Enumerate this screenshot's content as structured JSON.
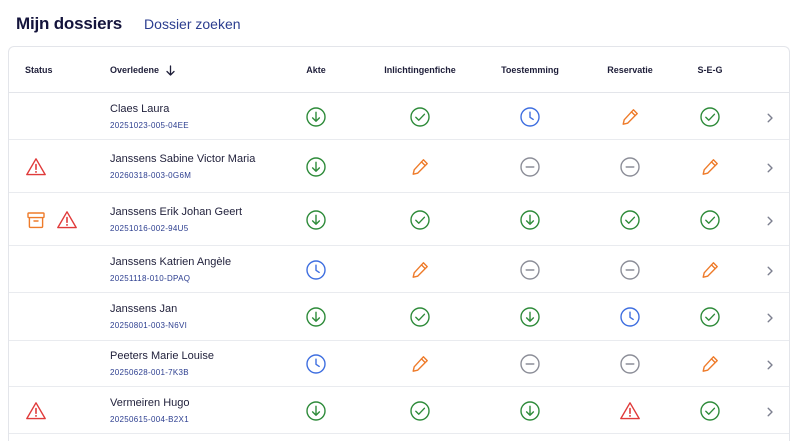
{
  "header": {
    "title": "Mijn dossiers",
    "search_link": "Dossier zoeken"
  },
  "table": {
    "columns": {
      "status": "Status",
      "overledene": "Overledene",
      "akte": "Akte",
      "inlichtingenfiche": "Inlichtingenfiche",
      "toestemming": "Toestemming",
      "reservatie": "Reservatie",
      "seg": "S-E-G"
    },
    "sort_icon": "arrow-down-icon",
    "rows": [
      {
        "name": "Claes Laura",
        "code": "20251023-005-04EE",
        "status": [],
        "akte": "download",
        "inlichtingenfiche": "check",
        "toestemming": "clock",
        "reservatie": "pencil",
        "seg": "check"
      },
      {
        "name": "Janssens Sabine Victor Maria",
        "code": "20260318-003-0G6M",
        "status": [
          "warning"
        ],
        "akte": "download",
        "inlichtingenfiche": "pencil",
        "toestemming": "minus",
        "reservatie": "minus",
        "seg": "pencil"
      },
      {
        "name": "Janssens Erik Johan Geert",
        "code": "20251016-002-94U5",
        "status": [
          "archive",
          "warning"
        ],
        "akte": "download",
        "inlichtingenfiche": "check",
        "toestemming": "download",
        "reservatie": "check",
        "seg": "check"
      },
      {
        "name": "Janssens Katrien Angèle",
        "code": "20251118-010-DPAQ",
        "status": [],
        "akte": "clock",
        "inlichtingenfiche": "pencil",
        "toestemming": "minus",
        "reservatie": "minus",
        "seg": "pencil"
      },
      {
        "name": "Janssens Jan",
        "code": "20250801-003-N6VI",
        "status": [],
        "akte": "download",
        "inlichtingenfiche": "check",
        "toestemming": "download",
        "reservatie": "clock",
        "seg": "check"
      },
      {
        "name": "Peeters Marie Louise",
        "code": "20250628-001-7K3B",
        "status": [],
        "akte": "clock",
        "inlichtingenfiche": "pencil",
        "toestemming": "minus",
        "reservatie": "minus",
        "seg": "pencil"
      },
      {
        "name": "Vermeiren Hugo",
        "code": "20250615-004-B2X1",
        "status": [
          "warning"
        ],
        "akte": "download",
        "inlichtingenfiche": "check",
        "toestemming": "download",
        "reservatie": "warning",
        "seg": "check"
      }
    ]
  },
  "colors": {
    "green": "#2e8b3a",
    "blue": "#3f6fe0",
    "orange": "#ee7b2a",
    "gray": "#8c8e98",
    "red": "#e03a3a",
    "navy": "#2b3d8f"
  }
}
